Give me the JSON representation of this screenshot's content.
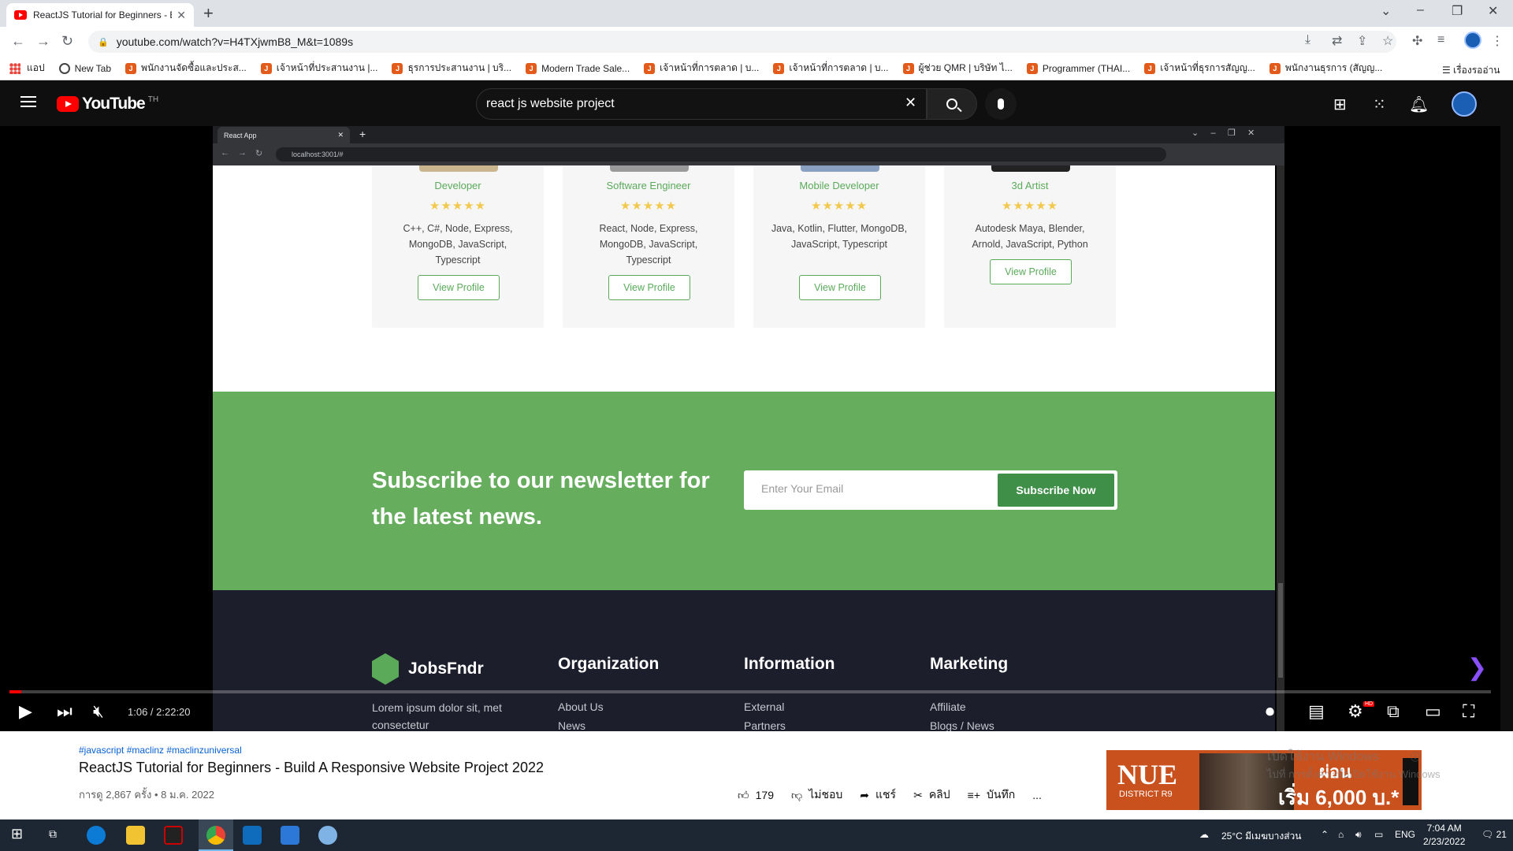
{
  "browser": {
    "tab_title": "ReactJS Tutorial for Beginners - B",
    "url": "youtube.com/watch?v=H4TXjwmB8_M&t=1089s",
    "bookmarks": [
      {
        "label": "แอป",
        "icon": "apps-icon"
      },
      {
        "label": "New Tab",
        "icon": "globe-icon"
      },
      {
        "label": "พนักงานจัดซื้อและประส...",
        "icon": "jt-icon"
      },
      {
        "label": "เจ้าหน้าที่ประสานงาน |...",
        "icon": "jt-icon"
      },
      {
        "label": "ธุรการประสานงาน | บริ...",
        "icon": "jt-icon"
      },
      {
        "label": "Modern Trade Sale...",
        "icon": "jt-icon"
      },
      {
        "label": "เจ้าหน้าที่การตลาด | บ...",
        "icon": "jt-icon"
      },
      {
        "label": "เจ้าหน้าที่การตลาด | บ...",
        "icon": "jt-icon"
      },
      {
        "label": "ผู้ช่วย QMR | บริษัท ไ...",
        "icon": "jt-icon"
      },
      {
        "label": "Programmer (THAI...",
        "icon": "jt-icon"
      },
      {
        "label": "เจ้าหน้าที่ธุรการสัญญ...",
        "icon": "jt-icon"
      },
      {
        "label": "พนักงานธุรการ (สัญญ...",
        "icon": "jt-icon"
      }
    ],
    "reading_list": "เรื่องรออ่าน"
  },
  "youtube": {
    "logo_text": "YouTube",
    "country": "TH",
    "search_query": "react js website project"
  },
  "inner_browser": {
    "tab_title": "React App",
    "url": "localhost:3001/#"
  },
  "page": {
    "cards": [
      {
        "role": "Developer",
        "stars": "★★★★★",
        "skills": "C++, C#, Node, Express, MongoDB, JavaScript, Typescript",
        "button": "View Profile"
      },
      {
        "role": "Software Engineer",
        "stars": "★★★★★",
        "skills": "React, Node, Express, MongoDB, JavaScript, Typescript",
        "button": "View Profile"
      },
      {
        "role": "Mobile Developer",
        "stars": "★★★★★",
        "skills": "Java, Kotlin, Flutter, MongoDB, JavaScript, Typescript",
        "button": "View Profile"
      },
      {
        "role": "3d Artist",
        "stars": "★★★★★",
        "skills": "Autodesk Maya, Blender, Arnold, JavaScript, Python",
        "button": "View Profile"
      }
    ],
    "newsletter": {
      "title": "Subscribe to our newsletter for the latest news.",
      "placeholder": "Enter Your Email",
      "button": "Subscribe Now"
    },
    "footer": {
      "brand": "JobsFndr",
      "description": "Lorem ipsum dolor sit, met consectetur",
      "columns": [
        {
          "heading": "Organization",
          "links": [
            "About Us",
            "News"
          ]
        },
        {
          "heading": "Information",
          "links": [
            "External",
            "Partners"
          ]
        },
        {
          "heading": "Marketing",
          "links": [
            "Affiliate",
            "Blogs / News"
          ]
        }
      ]
    }
  },
  "player": {
    "time": "1:06 / 2:22:20",
    "progress_fraction": 0.008,
    "hd_badge": "HD"
  },
  "video": {
    "tags": "#javascript #maclinz #maclinzuniversal",
    "title": "ReactJS Tutorial for Beginners - Build A Responsive Website Project 2022",
    "meta": "การดู 2,867 ครั้ง • 8 ม.ค. 2022",
    "likes": "179",
    "dislike_label": "ไม่ชอบ",
    "share_label": "แชร์",
    "clip_label": "คลิป",
    "save_label": "บันทึก",
    "more": "..."
  },
  "ad": {
    "brand": "NUE",
    "district": "DISTRICT R9",
    "promo1": "ผ่อน",
    "promo2": "เริ่ม 6,000 บ.*"
  },
  "watermark": {
    "line1": "เปิดใช้งาน Windows",
    "line2": "ไปที่ การตั้งค่า เพื่อเปิดใช้งาน Windows"
  },
  "taskbar": {
    "weather": "25°C มีเมฆบางส่วน",
    "lang": "ENG",
    "time": "7:04 AM",
    "date": "2/23/2022",
    "notif": "21"
  }
}
